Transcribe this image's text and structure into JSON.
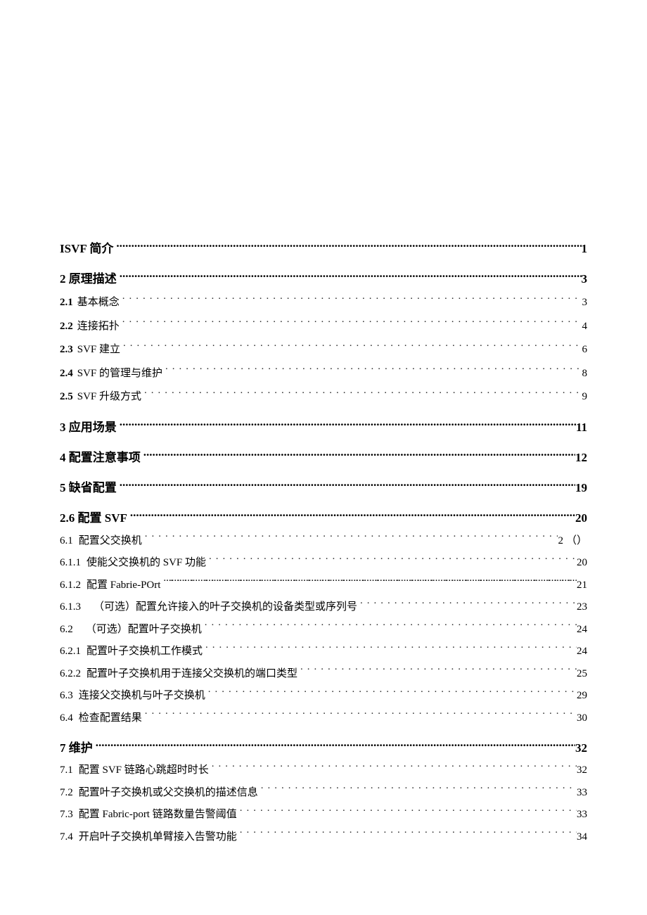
{
  "toc": [
    {
      "level": 1,
      "num": "",
      "title": "ISVF 简介",
      "page": "1",
      "suffix": "",
      "cls": "first"
    },
    {
      "level": 1,
      "num": "",
      "title": "2 原理描述",
      "page": "3",
      "suffix": ""
    },
    {
      "level": 2,
      "num": "2.1",
      "title": "基本概念",
      "page": "3",
      "suffix": ""
    },
    {
      "level": 2,
      "num": "2.2",
      "title": "连接拓扑",
      "page": "4",
      "suffix": ""
    },
    {
      "level": 2,
      "num": "2.3",
      "title": "SVF 建立",
      "page": "6",
      "suffix": ""
    },
    {
      "level": 2,
      "num": "2.4",
      "title": "SVF 的管理与维护",
      "page": "8",
      "suffix": ""
    },
    {
      "level": 2,
      "num": "2.5",
      "title": "SVF 升级方式",
      "page": "9",
      "suffix": ""
    },
    {
      "level": 1,
      "num": "",
      "title": "3 应用场景",
      "page": "11",
      "suffix": ""
    },
    {
      "level": 1,
      "num": "",
      "title": "4 配置注意事项",
      "page": "12",
      "suffix": ""
    },
    {
      "level": 1,
      "num": "",
      "title": "5 缺省配置",
      "page": "19",
      "suffix": ""
    },
    {
      "level": 1,
      "num": "",
      "title": "2.6 配置 SVF",
      "page": "20",
      "suffix": ""
    },
    {
      "level": 3,
      "num": "6.1",
      "title": "配置父交换机",
      "page": "2",
      "suffix": "（）"
    },
    {
      "level": 3,
      "num": "6.1.1",
      "title": "使能父交换机的 SVF 功能",
      "page": "20",
      "suffix": ""
    },
    {
      "level": 3,
      "num": "6.1.2",
      "title": "配置 Fabrie-POrt",
      "page": "21",
      "suffix": "",
      "dense": true
    },
    {
      "level": 3,
      "num": "6.1.3",
      "title": "（可选）配置允许接入的叶子交换机的设备类型或序列号",
      "page": "23",
      "suffix": "",
      "sub": true
    },
    {
      "level": 3,
      "num": "6.2",
      "title": "（可选）配置叶子交换机",
      "page": "24",
      "suffix": "",
      "sub": true
    },
    {
      "level": 3,
      "num": "6.2.1",
      "title": "配置叶子交换机工作模式",
      "page": "24",
      "suffix": ""
    },
    {
      "level": 3,
      "num": "6.2.2",
      "title": "配置叶子交换机用于连接父交换机的端口类型",
      "page": "25",
      "suffix": ""
    },
    {
      "level": 3,
      "num": "6.3",
      "title": "连接父交换机与叶子交换机",
      "page": "29",
      "suffix": ""
    },
    {
      "level": 3,
      "num": "6.4",
      "title": "检查配置结果",
      "page": "30",
      "suffix": ""
    },
    {
      "level": 1,
      "num": "",
      "title": "7 维护",
      "page": "32",
      "suffix": ""
    },
    {
      "level": 3,
      "num": "7.1",
      "title": "配置 SVF 链路心跳超时时长",
      "page": "32",
      "suffix": ""
    },
    {
      "level": 3,
      "num": "7.2",
      "title": "配置叶子交换机或父交换机的描述信息",
      "page": "33",
      "suffix": ""
    },
    {
      "level": 3,
      "num": "7.3",
      "title": "配置 Fabric-port 链路数量告警阈值",
      "page": "33",
      "suffix": ""
    },
    {
      "level": 3,
      "num": "7.4",
      "title": "开启叶子交换机单臂接入告警功能",
      "page": "34",
      "suffix": ""
    }
  ]
}
